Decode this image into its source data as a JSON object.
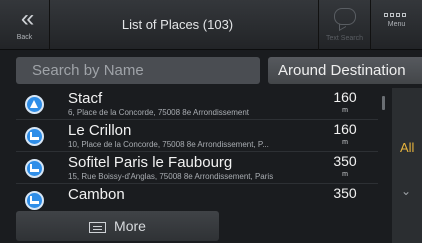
{
  "header": {
    "back_label": "Back",
    "back_icon": "double-chevron-left",
    "title": "List of Places (103)",
    "speech_label": "Text Search",
    "menu_label": "Menu"
  },
  "search": {
    "placeholder": "Search by Name",
    "filter_label": "Around Destination"
  },
  "places": [
    {
      "name": "Stacf",
      "address": "6, Place de la Concorde, 75008 8e Arrondissement",
      "distance": "160",
      "unit": "m",
      "icon": "poi-triangle-icon"
    },
    {
      "name": "Le Crillon",
      "address": "10, Place de la Concorde, 75008 8e Arrondissement, P...",
      "distance": "160",
      "unit": "m",
      "icon": "hotel-bed-icon"
    },
    {
      "name": "Sofitel Paris le Faubourg",
      "address": "15, Rue Boissy-d'Anglas, 75008 8e Arrondissement, Paris",
      "distance": "350",
      "unit": "m",
      "icon": "hotel-bed-icon"
    },
    {
      "name": "Cambon",
      "address": "",
      "distance": "350",
      "unit": "",
      "icon": "hotel-bed-icon"
    }
  ],
  "side_panel": {
    "all_label": "All"
  },
  "more_label": "More",
  "colors": {
    "accent": "#e6b33d",
    "poi_blue": "#2f8ee8",
    "background": "#1a1c1f"
  }
}
